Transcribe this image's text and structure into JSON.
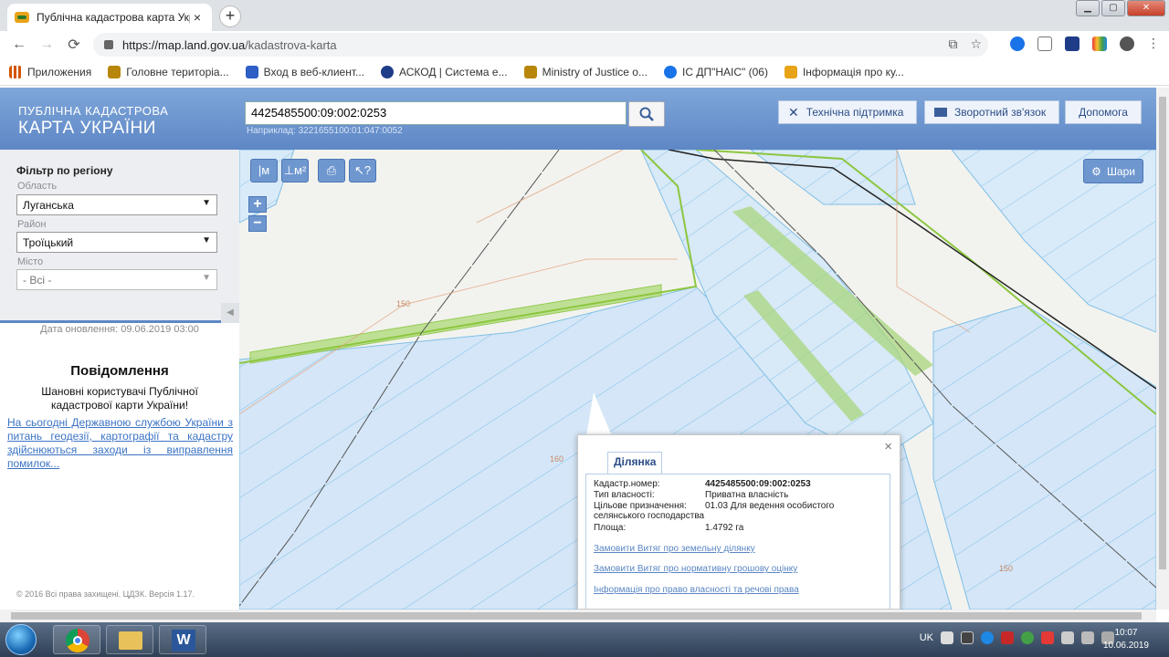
{
  "browser": {
    "tab_title": "Публічна кадастрова карта Укр",
    "tab_close": "×",
    "new_tab": "+",
    "url_host": "https://map.land.gov.ua",
    "url_path": "/kadastrova-karta",
    "bookmarks": [
      {
        "label": "Приложения",
        "color": "#d35400"
      },
      {
        "label": "Головне територіа...",
        "color": "#b8860b"
      },
      {
        "label": "Вход в веб-клиент...",
        "color": "#2d5fc4"
      },
      {
        "label": "АСКОД | Система е...",
        "color": "#1f3c88"
      },
      {
        "label": "Ministry of Justice o...",
        "color": "#b8860b"
      },
      {
        "label": "ІС ДП\"НАІС\" (06)",
        "color": "#1a73e8"
      },
      {
        "label": "Інформація про ку...",
        "color": "#e8a317"
      }
    ]
  },
  "header": {
    "logo_line1": "ПУБЛІЧНА КАДАСТРОВА",
    "logo_line2": "КАРТА УКРАЇНИ",
    "search_value": "4425485500:09:002:0253",
    "search_hint": "Наприклад: 3221655100:01:047:0052",
    "btn_support": "Технічна підтримка",
    "btn_feedback": "Зворотний зв'язок",
    "btn_help": "Допомога"
  },
  "filter": {
    "title": "Фільтр по регіону",
    "oblast_label": "Область",
    "oblast_value": "Луганська",
    "rayon_label": "Район",
    "rayon_value": "Троїцький",
    "misto_label": "Місто",
    "misto_value": "- Всі -",
    "collapse": "◀"
  },
  "info": {
    "update_date": "Дата оновлення: 09.06.2019 03:00",
    "notice_title": "Повідомлення",
    "notice_text": "Шановні користувачі Публічної кадастрової карти України!",
    "notice_link": "На сьогодні Державною службою України з питань геодезії, картографії та кадастру здійснюються заходи із виправлення помилок...",
    "copyright": "© 2016 Всі права захищені. ЦДЗК. Версія 1.17."
  },
  "map": {
    "tools": [
      "|м",
      "⊥м²",
      "⎙",
      "↖?"
    ],
    "zoom_in": "+",
    "zoom_out": "−",
    "layers_label": "Шари",
    "contour_labels": [
      "150",
      "160",
      "150"
    ]
  },
  "popup": {
    "close": "×",
    "tab": "Ділянка",
    "fields": [
      {
        "k": "Кадастр.номер:",
        "v": "4425485500:09:002:0253"
      },
      {
        "k": "Тип власності:",
        "v": "Приватна власність"
      },
      {
        "k": "Цільове призначення:",
        "v": "01.03 Для ведення особистого селянського господарства"
      },
      {
        "k": "Площа:",
        "v": "1.4792 га"
      }
    ],
    "links": [
      "Замовити Витяг про земельну ділянку",
      "Замовити Витяг про нормативну грошову оцінку",
      "Інформація про право власності та речові права"
    ]
  },
  "taskbar": {
    "lang": "UK",
    "time": "10:07",
    "date": "10.06.2019"
  }
}
